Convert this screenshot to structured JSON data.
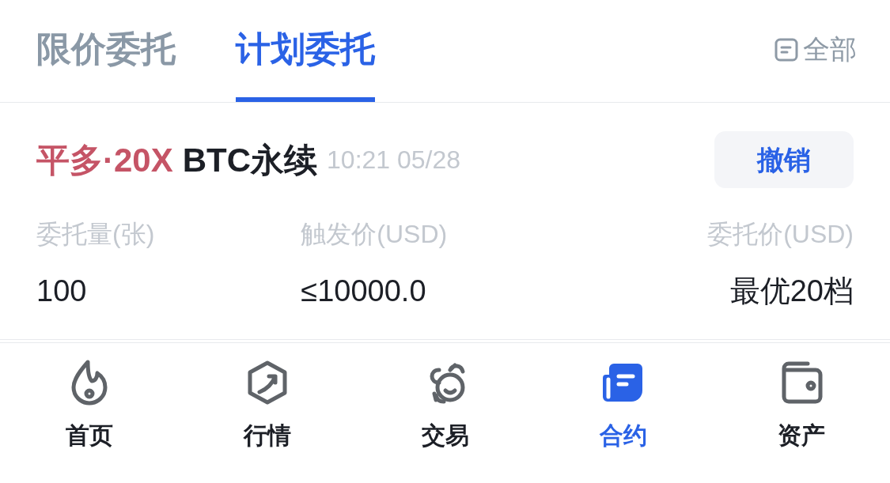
{
  "tabs": [
    {
      "label": "限价委托",
      "selected": false
    },
    {
      "label": "计划委托",
      "selected": true
    }
  ],
  "filter": {
    "label": "全部"
  },
  "orders": [
    {
      "direction": "平多·20X",
      "symbol": "BTC永续",
      "time": "10:21 05/28",
      "cancel": "撤销",
      "fields": [
        {
          "label": "委托量(张)",
          "value": "100"
        },
        {
          "label": "触发价(USD)",
          "value": "≤10000.0"
        },
        {
          "label": "委托价(USD)",
          "value": "最优20档"
        }
      ]
    }
  ],
  "nav": [
    {
      "label": "首页",
      "selected": false
    },
    {
      "label": "行情",
      "selected": false
    },
    {
      "label": "交易",
      "selected": false
    },
    {
      "label": "合约",
      "selected": true
    },
    {
      "label": "资产",
      "selected": false
    }
  ]
}
